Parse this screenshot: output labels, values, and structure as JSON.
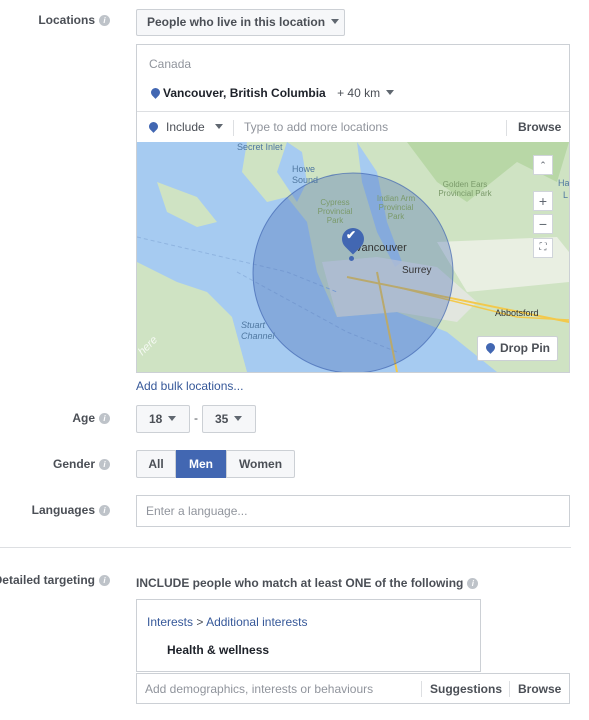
{
  "locations": {
    "label": "Locations",
    "type_dropdown": "People who live in this location",
    "country": "Canada",
    "location_name": "Vancouver, British Columbia",
    "radius": "+ 40 km",
    "include_label": "Include",
    "search_placeholder": "Type to add more locations",
    "browse_label": "Browse",
    "bulk_link": "Add bulk locations..."
  },
  "map": {
    "labels": [
      "Secret Inlet",
      "Howe Sound",
      "Cypress Provincial Park",
      "Indian Arm Provincial Park",
      "Golden Ears Provincial Park",
      "Vancouver",
      "Surrey",
      "Abbotsford",
      "Stuart Channel",
      "Ha",
      "L"
    ],
    "zoom_in": "+",
    "zoom_out": "−",
    "drop_pin": "Drop Pin",
    "watermark": "here"
  },
  "age": {
    "label": "Age",
    "min": "18",
    "separator": "-",
    "max": "35"
  },
  "gender": {
    "label": "Gender",
    "options": [
      "All",
      "Men",
      "Women"
    ],
    "selected": "Men"
  },
  "languages": {
    "label": "Languages",
    "placeholder": "Enter a language..."
  },
  "detailed_targeting": {
    "label": "Detailed targeting",
    "description": "INCLUDE people who match at least ONE of the following",
    "breadcrumb_root": "Interests",
    "breadcrumb_sep": ">",
    "breadcrumb_child": "Additional interests",
    "selected_interest": "Health & wellness",
    "search_placeholder": "Add demographics, interests or behaviours",
    "suggestions_label": "Suggestions",
    "browse_label": "Browse"
  },
  "colors": {
    "accent": "#4267b2",
    "link": "#365899",
    "border": "#ccd0d5",
    "water": "#a6cbf1",
    "land": "#cfe3c3"
  }
}
